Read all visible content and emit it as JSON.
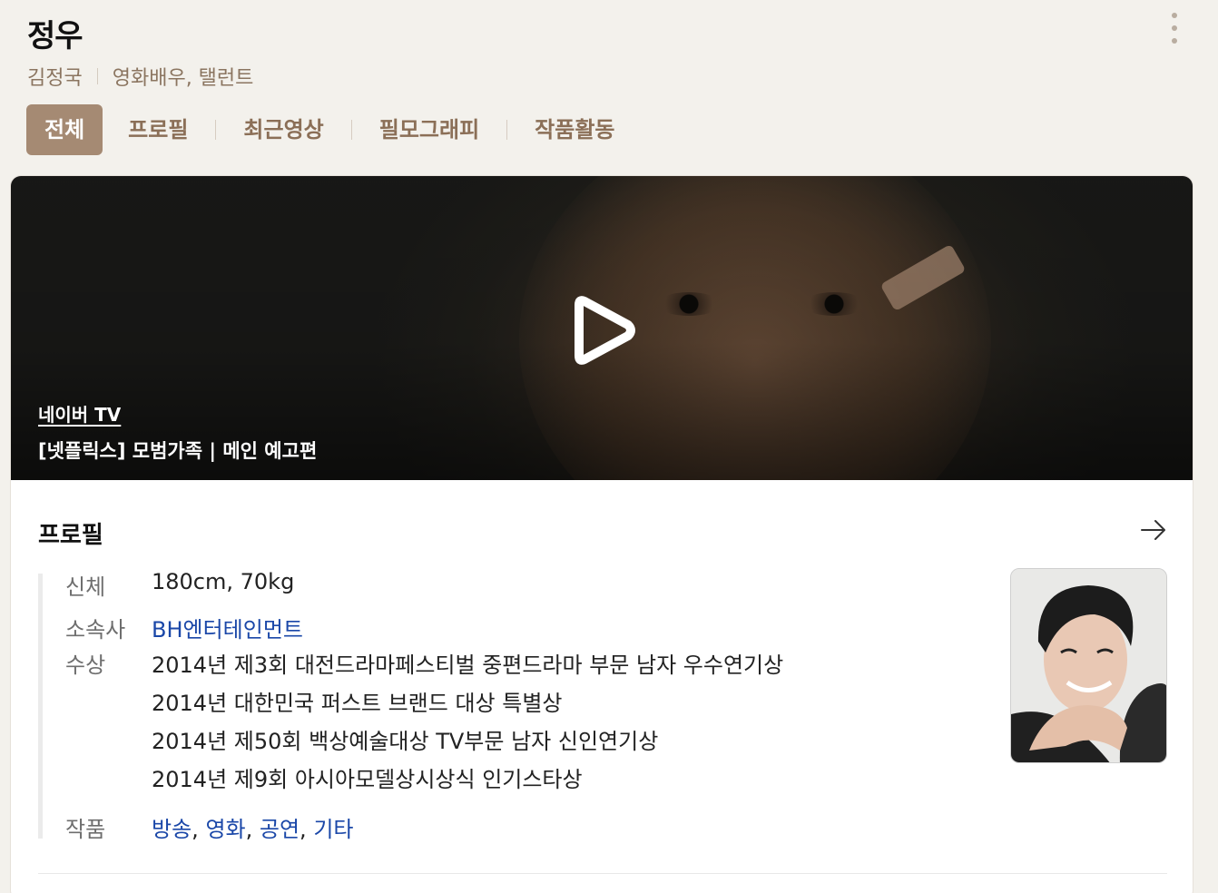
{
  "header": {
    "name": "정우",
    "real_name": "김정국",
    "occupation": "영화배우, 탤런트"
  },
  "tabs": [
    "전체",
    "프로필",
    "최근영상",
    "필모그래피",
    "작품활동"
  ],
  "video": {
    "source": "네이버 TV",
    "title": "[넷플릭스] 모범가족 | 메인 예고편"
  },
  "profile": {
    "heading": "프로필",
    "body_label": "신체",
    "body_value": "180cm, 70kg",
    "agency_label": "소속사",
    "agency_value": "BH엔터테인먼트",
    "awards_label": "수상",
    "awards": [
      "2014년 제3회 대전드라마페스티벌 중편드라마 부문 남자 우수연기상",
      "2014년 대한민국 퍼스트 브랜드 대상 특별상",
      "2014년 제50회 백상예술대상 TV부문 남자 신인연기상",
      "2014년 제9회 아시아모델상시상식 인기스타상"
    ],
    "works_label": "작품",
    "works": [
      "방송",
      "영화",
      "공연",
      "기타"
    ]
  },
  "colors": {
    "accent": "#a58a73",
    "link": "#1a47a8",
    "background": "#f3f1ec"
  },
  "icons": {
    "more": "more-vertical-icon",
    "play": "play-icon",
    "arrow": "arrow-right-icon"
  }
}
